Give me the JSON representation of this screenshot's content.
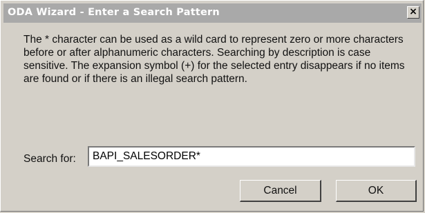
{
  "window": {
    "title": "ODA Wizard - Enter a Search Pattern",
    "close_glyph": "×"
  },
  "description": "The * character can be used as a wild card to represent zero or more characters before or after alphanumeric characters. Searching by description is case sensitive. The expansion symbol (+) for the selected entry disappears if no items are found or if there is an illegal search pattern.",
  "search": {
    "label": "Search for:",
    "value": "BAPI_SALESORDER*"
  },
  "buttons": {
    "cancel_label": "Cancel",
    "ok_label": "OK"
  },
  "colors": {
    "dialog_face": "#d4d0c8",
    "titlebar_inactive": "#a9a9a9"
  }
}
